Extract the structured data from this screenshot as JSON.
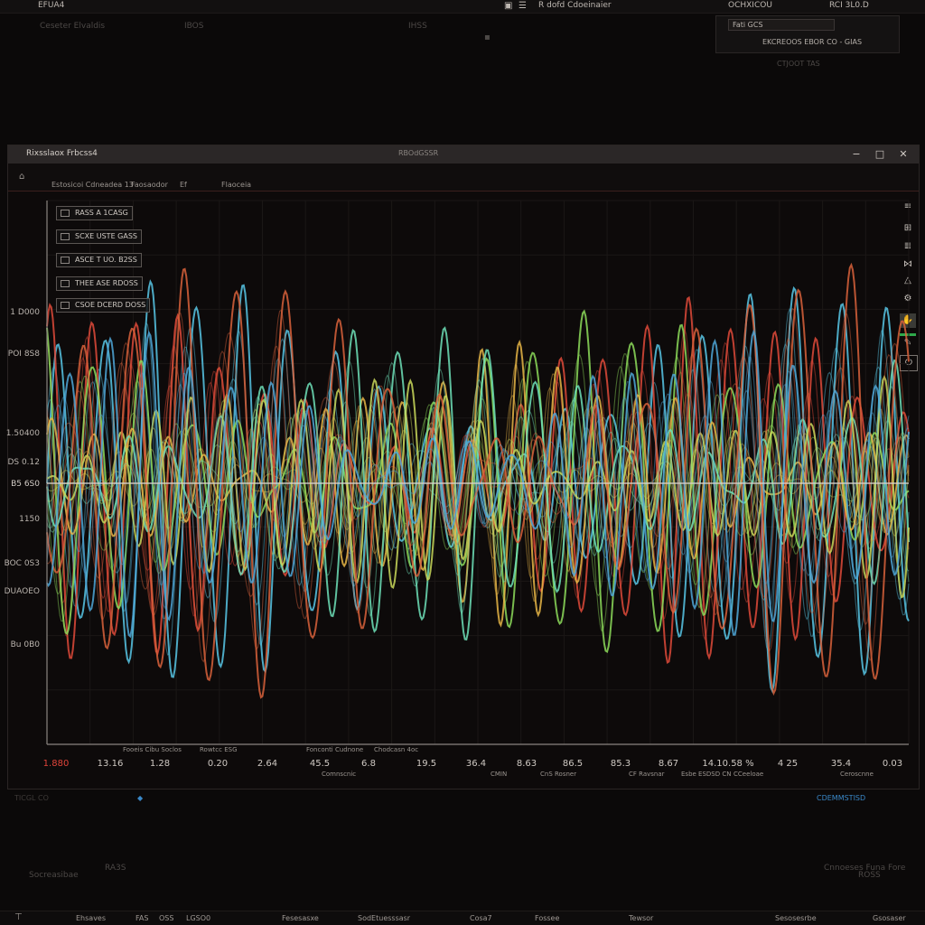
{
  "topbar": {
    "app_label": "EFUA4",
    "center_label": "R dofd Cdoeinaier",
    "right_label": "OCHXICOU",
    "zoom_label": "RCI 3L0.D"
  },
  "top_row": {
    "left_text": "Ceseter Elvaldis",
    "mid_text": "IBOS",
    "mid2_text": "IHSS"
  },
  "top_panel": {
    "field_value": "Fati GCS",
    "line2": "EKCREOOS EBOR CO - GIAS",
    "line3": "CTJOOT TAS"
  },
  "window": {
    "title": "Rixsslaox Frbcss4",
    "center": "RBOdGSSR",
    "min_glyph": "−",
    "max_glyph": "□",
    "close_glyph": "✕",
    "toolbar_items": [
      "Estosicoi Cdneadea 13",
      "Faosaodor",
      "Ef",
      "Flaoceia"
    ]
  },
  "legend_boxes": [
    {
      "line1": "RASS A 1CASG"
    },
    {
      "line1": "SCXE USTE GASS"
    },
    {
      "line1": "ASCE T UO. B2SS"
    },
    {
      "line1": "THEE ASE RDOSS"
    },
    {
      "line1": "CSOE DCERD DOSS"
    }
  ],
  "side_tools": [
    "≡",
    "⊞",
    "≣",
    "⋈",
    "△",
    "⚙",
    "✋",
    "✎",
    "⏻"
  ],
  "status": {
    "left": "TICGL CO",
    "right": "CDEMMSTISD",
    "bottom_left": "Socreasibae",
    "bottom_mid": "RA3S",
    "bottom_right": "Cnnoeses Funa Fore",
    "bottom_right2": "ROSS"
  },
  "taskbar_items": [
    "Ehsaves",
    "FAS",
    "OSS",
    "LGSO0",
    "Fesesasxe",
    "SodEtuesssasr",
    "Cosa7",
    "Fossee",
    "Tewsor",
    "Sesosesrbe",
    "Gsosaser"
  ],
  "chart_data": {
    "type": "line",
    "title": "",
    "xlabel": "",
    "ylabel": "",
    "yticks": [
      "1 D000",
      "POI 8S8",
      "1.50400",
      "DS 0.12",
      "1150",
      "BOC 0S3",
      "DUAOEO",
      "Bu 0B0"
    ],
    "xticks": [
      "1.880",
      "13.16",
      "1.28",
      "0.20",
      "2.64",
      "45.5",
      "6.8",
      "19.5",
      "36.4",
      "8.63",
      "86.5",
      "85.3",
      "8.67",
      "14.10.58 %",
      "4 25",
      "35.4",
      "0.03"
    ],
    "x_sublabels": [
      "Fooeis Cibu Soclos",
      "Rowtcc ESG",
      "Fonconti Cudnone",
      "Chodcasn 4oc",
      "Comnscnic",
      "CMIN",
      "CnS Rosner",
      "CF Ravsnar",
      "Esbe ESDSD CN",
      "CCeeloae",
      "Ceroscnne"
    ],
    "x_range": [
      0,
      100
    ],
    "y_range": [
      -1.2,
      1.2
    ],
    "grid": true,
    "baseline_label": "B5 6S0",
    "series": [
      {
        "color": "#58c7e6",
        "amp": 0.85,
        "freq": 0.49,
        "phase": 0.0
      },
      {
        "color": "#e04a3a",
        "amp": 0.75,
        "freq": 0.53,
        "phase": 1.1
      },
      {
        "color": "#8ddc5a",
        "amp": 0.7,
        "freq": 0.46,
        "phase": 2.0
      },
      {
        "color": "#e8b646",
        "amp": 0.55,
        "freq": 0.58,
        "phase": 0.6
      },
      {
        "color": "#6fe0b8",
        "amp": 0.65,
        "freq": 0.5,
        "phase": 2.9
      },
      {
        "color": "#c9d85a",
        "amp": 0.45,
        "freq": 0.62,
        "phase": 1.7
      },
      {
        "color": "#d9623b",
        "amp": 0.9,
        "freq": 0.44,
        "phase": 3.6
      },
      {
        "color": "#4fa7d8",
        "amp": 0.6,
        "freq": 0.56,
        "phase": 4.4
      }
    ]
  }
}
